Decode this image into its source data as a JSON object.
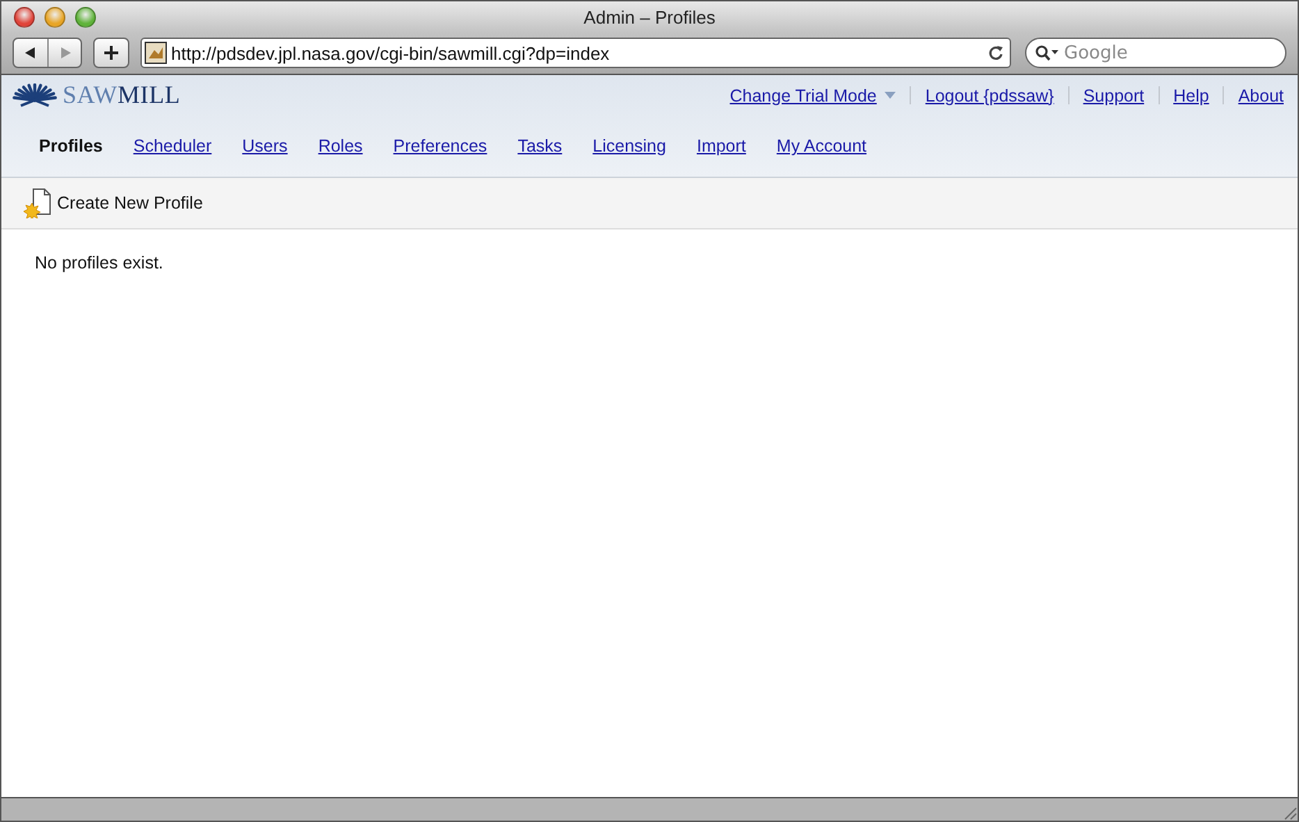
{
  "window": {
    "title": "Admin – Profiles"
  },
  "browser": {
    "url": "http://pdsdev.jpl.nasa.gov/cgi-bin/sawmill.cgi?dp=index",
    "search_placeholder": "Google"
  },
  "logo": {
    "parts": [
      "SAW",
      "MILL"
    ]
  },
  "top_links": [
    {
      "label": "Change Trial Mode",
      "dropdown": true
    },
    {
      "label": "Logout {pdssaw}",
      "dropdown": false
    },
    {
      "label": "Support",
      "dropdown": false
    },
    {
      "label": "Help",
      "dropdown": false
    },
    {
      "label": "About",
      "dropdown": false
    }
  ],
  "tabs": [
    {
      "label": "Profiles",
      "selected": true
    },
    {
      "label": "Scheduler",
      "selected": false
    },
    {
      "label": "Users",
      "selected": false
    },
    {
      "label": "Roles",
      "selected": false
    },
    {
      "label": "Preferences",
      "selected": false
    },
    {
      "label": "Tasks",
      "selected": false
    },
    {
      "label": "Licensing",
      "selected": false
    },
    {
      "label": "Import",
      "selected": false
    },
    {
      "label": "My Account",
      "selected": false
    }
  ],
  "actions": [
    {
      "label": "Create New Profile"
    }
  ],
  "message": "No profiles exist."
}
